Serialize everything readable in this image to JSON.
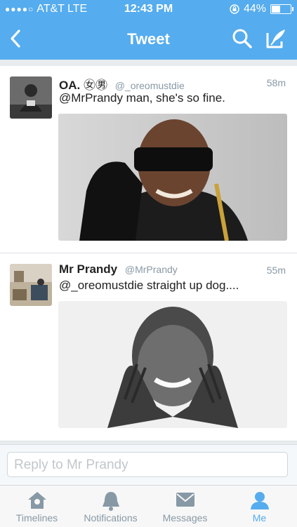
{
  "status_bar": {
    "carrier": "AT&T",
    "network": "LTE",
    "time": "12:43 PM",
    "battery": "44%",
    "battery_level": 0.44
  },
  "nav": {
    "title": "Tweet",
    "back_icon": "chevron-left-icon",
    "search_icon": "search-icon",
    "compose_icon": "compose-icon"
  },
  "tweets": [
    {
      "name": "OA.",
      "name_emoji": "㊛㊚",
      "handle": "@_oreomustdie",
      "time": "58m",
      "text": "@MrPrandy man, she's so fine."
    },
    {
      "name": "Mr Prandy",
      "handle": "@MrPrandy",
      "time": "55m",
      "text": "@_oreomustdie straight up dog...."
    }
  ],
  "reply": {
    "placeholder": "Reply to Mr Prandy"
  },
  "tabs": [
    {
      "label": "Timelines",
      "icon": "home-icon",
      "active": false
    },
    {
      "label": "Notifications",
      "icon": "bell-icon",
      "active": false
    },
    {
      "label": "Messages",
      "icon": "envelope-icon",
      "active": false
    },
    {
      "label": "Me",
      "icon": "person-icon",
      "active": true
    }
  ],
  "colors": {
    "brand": "#55acee",
    "muted": "#8899a6"
  }
}
